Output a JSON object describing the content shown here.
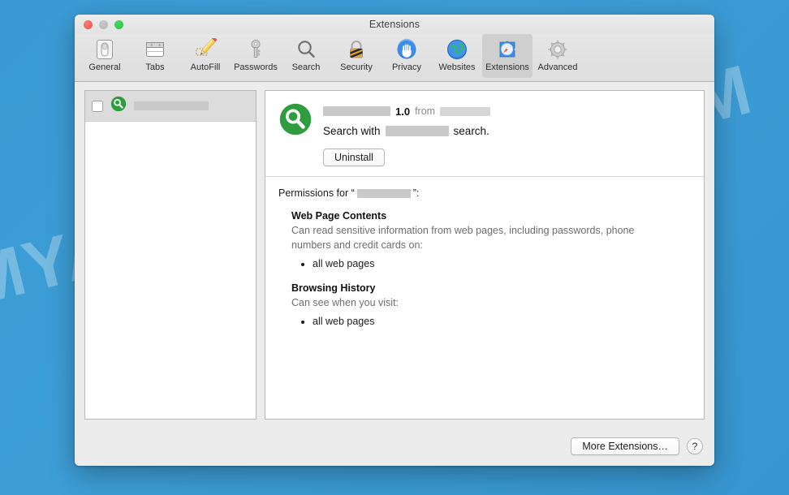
{
  "watermark": {
    "text": "MYANTISPYWARE.COM"
  },
  "window": {
    "title": "Extensions",
    "traffic_lights": {
      "close_label": "Close",
      "minimize_label": "Minimize",
      "zoom_label": "Zoom"
    }
  },
  "toolbar": {
    "selected": "Extensions",
    "items": [
      {
        "label": "General",
        "icon": "general-switch-icon"
      },
      {
        "label": "Tabs",
        "icon": "tabs-icon"
      },
      {
        "label": "AutoFill",
        "icon": "autofill-pencil-icon"
      },
      {
        "label": "Passwords",
        "icon": "passwords-key-icon"
      },
      {
        "label": "Search",
        "icon": "search-magnifier-icon"
      },
      {
        "label": "Security",
        "icon": "security-padlock-icon"
      },
      {
        "label": "Privacy",
        "icon": "privacy-hand-icon"
      },
      {
        "label": "Websites",
        "icon": "websites-globe-icon"
      },
      {
        "label": "Extensions",
        "icon": "extensions-puzzle-compass-icon"
      },
      {
        "label": "Advanced",
        "icon": "advanced-gear-icon"
      }
    ]
  },
  "sidebar": {
    "rows": [
      {
        "checked": false,
        "icon": "green-magnifier-icon",
        "name_redacted": true,
        "name": ""
      }
    ]
  },
  "detail": {
    "icon": "green-magnifier-icon",
    "name_redacted": true,
    "name": "",
    "version": "1.0",
    "from_label": "from",
    "vendor_redacted": true,
    "vendor": "",
    "description_prefix": "Search with",
    "description_engine_redacted": true,
    "description_engine": "",
    "description_suffix": "search.",
    "uninstall_label": "Uninstall",
    "permissions_prefix": "Permissions for “",
    "permissions_name_redacted": true,
    "permissions_name": "",
    "permissions_suffix": "”:",
    "groups": [
      {
        "heading": "Web Page Contents",
        "description": "Can read sensitive information from web pages, including passwords, phone numbers and credit cards on:",
        "items": [
          "all web pages"
        ]
      },
      {
        "heading": "Browsing History",
        "description": "Can see when you visit:",
        "items": [
          "all web pages"
        ]
      }
    ]
  },
  "footer": {
    "more_extensions_label": "More Extensions…",
    "help_label": "?"
  },
  "colors": {
    "desktop_blue": "#3a9bd4",
    "extension_green": "#2e9c3f",
    "selected_toolbar": "#cfcfcf",
    "close_red": "#ef4f45",
    "minimize_gray": "#b4b4b4",
    "zoom_green": "#28c840"
  }
}
